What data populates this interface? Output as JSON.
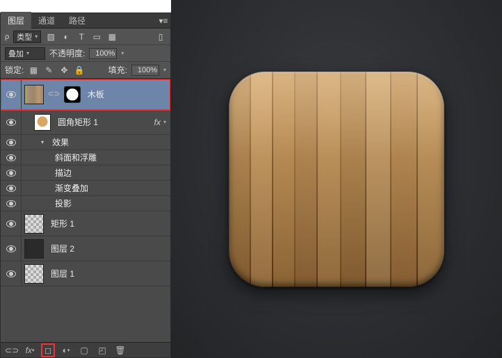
{
  "tabs": {
    "layers": "图层",
    "channels": "通道",
    "paths": "路径"
  },
  "filter_row": {
    "kind_label": "类型",
    "icons": [
      "image-filter-icon",
      "adjust-filter-icon",
      "type-filter-icon",
      "shape-filter-icon",
      "smart-filter-icon"
    ]
  },
  "blend_row": {
    "mode": "叠加",
    "opacity_label": "不透明度:",
    "opacity_value": "100%"
  },
  "lock_row": {
    "lock_label": "锁定:",
    "fill_label": "填充:",
    "fill_value": "100%"
  },
  "layers": [
    {
      "name": "木板",
      "selected": true
    },
    {
      "name": "圆角矩形 1",
      "has_fx": true
    },
    {
      "effects_label": "效果"
    },
    {
      "fx1": "斜面和浮雕"
    },
    {
      "fx2": "描边"
    },
    {
      "fx3": "渐变叠加"
    },
    {
      "fx4": "投影"
    },
    {
      "name2": "矩形 1"
    },
    {
      "name3": "图层 2"
    },
    {
      "name4": "图层 1"
    }
  ],
  "footer_icons": [
    "link-icon",
    "fx-icon",
    "mask-icon",
    "adjustment-icon",
    "group-icon",
    "new-layer-icon",
    "trash-icon"
  ]
}
